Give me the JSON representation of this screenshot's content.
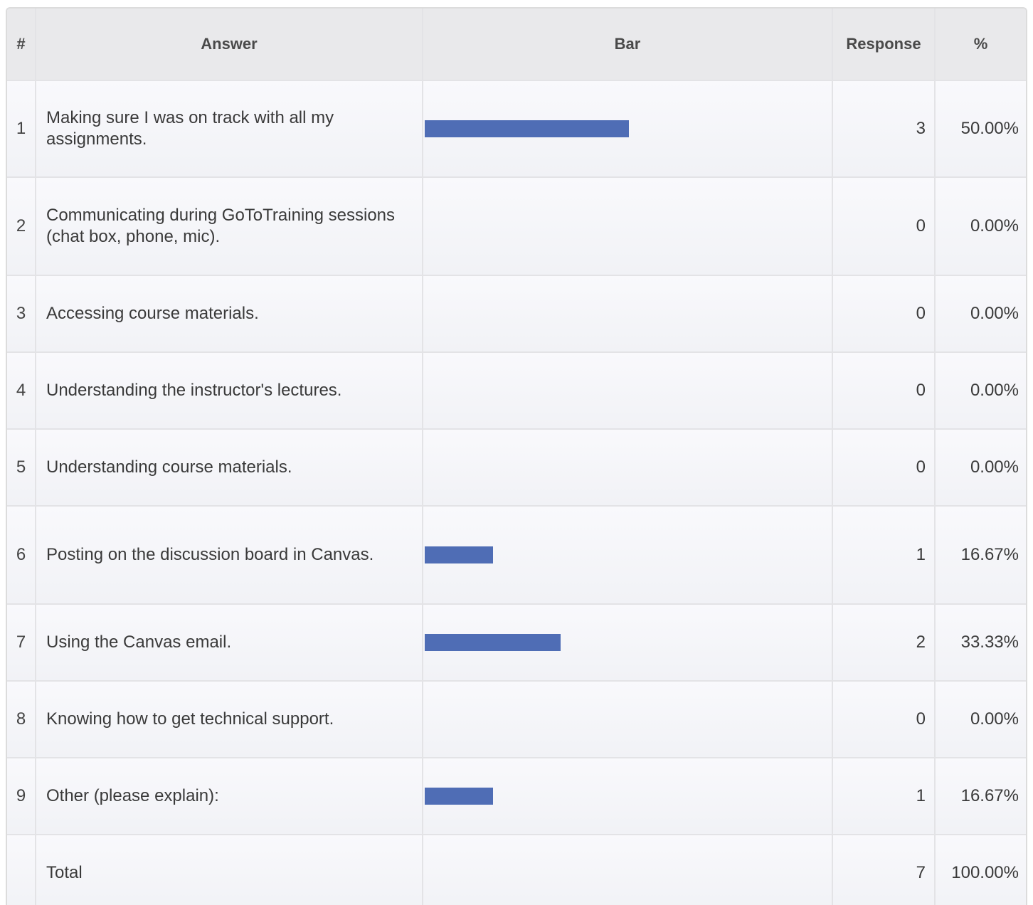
{
  "table": {
    "headers": {
      "num": "#",
      "answer": "Answer",
      "bar": "Bar",
      "response": "Response",
      "percent": "%"
    },
    "rows": [
      {
        "num": "1",
        "answer": "Making sure I was on track with all my assignments.",
        "response": "3",
        "percent": "50.00%",
        "fraction": 0.5
      },
      {
        "num": "2",
        "answer": "Communicating during GoToTraining sessions (chat box, phone, mic).",
        "response": "0",
        "percent": "0.00%",
        "fraction": 0
      },
      {
        "num": "3",
        "answer": "Accessing course materials.",
        "response": "0",
        "percent": "0.00%",
        "fraction": 0
      },
      {
        "num": "4",
        "answer": "Understanding the instructor's lectures.",
        "response": "0",
        "percent": "0.00%",
        "fraction": 0
      },
      {
        "num": "5",
        "answer": "Understanding course materials.",
        "response": "0",
        "percent": "0.00%",
        "fraction": 0
      },
      {
        "num": "6",
        "answer": "Posting on the discussion board in Canvas.",
        "response": "1",
        "percent": "16.67%",
        "fraction": 0.1667
      },
      {
        "num": "7",
        "answer": "Using the Canvas email.",
        "response": "2",
        "percent": "33.33%",
        "fraction": 0.3333
      },
      {
        "num": "8",
        "answer": "Knowing how to get technical support.",
        "response": "0",
        "percent": "0.00%",
        "fraction": 0
      },
      {
        "num": "9",
        "answer": "Other (please explain):",
        "response": "1",
        "percent": "16.67%",
        "fraction": 0.1667
      }
    ],
    "total": {
      "label": "Total",
      "response": "7",
      "percent": "100.00%"
    }
  },
  "colors": {
    "bar": "#4f6db5",
    "header_bg": "#e9e9eb"
  }
}
